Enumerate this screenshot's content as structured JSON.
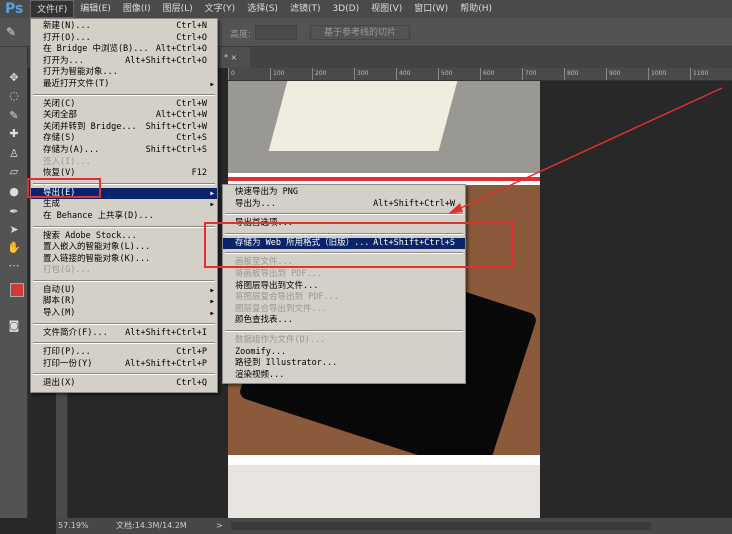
{
  "app": {
    "logo": "Ps"
  },
  "menubar": [
    "文件(F)",
    "编辑(E)",
    "图像(I)",
    "图层(L)",
    "文字(Y)",
    "选择(S)",
    "滤镜(T)",
    "3D(D)",
    "视图(V)",
    "窗口(W)",
    "帮助(H)"
  ],
  "options": {
    "height_label": "高度:",
    "slice_button": "基于参考线的切片"
  },
  "tab": {
    "label": "* ×"
  },
  "ruler": [
    "0",
    "100",
    "200",
    "300",
    "400",
    "500",
    "600",
    "700",
    "800",
    "900",
    "1000",
    "1100"
  ],
  "status": {
    "zoom": "57.19%",
    "doc": "文档:14.3M/14.2M",
    "arrow": ">"
  },
  "file_menu": [
    {
      "label": "新建(N)...",
      "shortcut": "Ctrl+N"
    },
    {
      "label": "打开(O)...",
      "shortcut": "Ctrl+O"
    },
    {
      "label": "在 Bridge 中浏览(B)...",
      "shortcut": "Alt+Ctrl+O"
    },
    {
      "label": "打开为...",
      "shortcut": "Alt+Shift+Ctrl+O"
    },
    {
      "label": "打开为智能对象...",
      "shortcut": ""
    },
    {
      "label": "最近打开文件(T)",
      "shortcut": "",
      "sub": true
    },
    {
      "sep": true
    },
    {
      "label": "关闭(C)",
      "shortcut": "Ctrl+W"
    },
    {
      "label": "关闭全部",
      "shortcut": "Alt+Ctrl+W"
    },
    {
      "label": "关闭并转到 Bridge...",
      "shortcut": "Shift+Ctrl+W"
    },
    {
      "label": "存储(S)",
      "shortcut": "Ctrl+S"
    },
    {
      "label": "存储为(A)...",
      "shortcut": "Shift+Ctrl+S"
    },
    {
      "label": "签入(I)...",
      "shortcut": "",
      "dis": true
    },
    {
      "label": "恢复(V)",
      "shortcut": "F12"
    },
    {
      "sep": true
    },
    {
      "label": "导出(E)",
      "shortcut": "",
      "sub": true,
      "hl": true
    },
    {
      "label": "生成",
      "shortcut": "",
      "sub": true
    },
    {
      "label": "在 Behance 上共享(D)...",
      "shortcut": ""
    },
    {
      "sep": true
    },
    {
      "label": "搜索 Adobe Stock...",
      "shortcut": ""
    },
    {
      "label": "置入嵌入的智能对象(L)...",
      "shortcut": ""
    },
    {
      "label": "置入链接的智能对象(K)...",
      "shortcut": ""
    },
    {
      "label": "打包(G)...",
      "shortcut": "",
      "dis": true
    },
    {
      "sep": true
    },
    {
      "label": "自动(U)",
      "shortcut": "",
      "sub": true
    },
    {
      "label": "脚本(R)",
      "shortcut": "",
      "sub": true
    },
    {
      "label": "导入(M)",
      "shortcut": "",
      "sub": true
    },
    {
      "sep": true
    },
    {
      "label": "文件简介(F)...",
      "shortcut": "Alt+Shift+Ctrl+I"
    },
    {
      "sep": true
    },
    {
      "label": "打印(P)...",
      "shortcut": "Ctrl+P"
    },
    {
      "label": "打印一份(Y)",
      "shortcut": "Alt+Shift+Ctrl+P"
    },
    {
      "sep": true
    },
    {
      "label": "退出(X)",
      "shortcut": "Ctrl+Q"
    }
  ],
  "export_menu": [
    {
      "label": "快速导出为 PNG",
      "shortcut": ""
    },
    {
      "label": "导出为...",
      "shortcut": "Alt+Shift+Ctrl+W"
    },
    {
      "sep": true
    },
    {
      "label": "导出首选项...",
      "shortcut": ""
    },
    {
      "sep": true
    },
    {
      "label": "存储为 Web 所用格式（旧版）...",
      "shortcut": "Alt+Shift+Ctrl+S",
      "hl": true
    },
    {
      "sep": true
    },
    {
      "label": "画板至文件...",
      "shortcut": "",
      "dis": true
    },
    {
      "label": "将画板导出到 PDF...",
      "shortcut": "",
      "dis": true
    },
    {
      "label": "将图层导出到文件...",
      "shortcut": ""
    },
    {
      "label": "将图层复合导出到 PDF...",
      "shortcut": "",
      "dis": true
    },
    {
      "label": "图层复合导出到文件...",
      "shortcut": "",
      "dis": true
    },
    {
      "label": "颜色查找表...",
      "shortcut": ""
    },
    {
      "sep": true
    },
    {
      "label": "数据组作为文件(D)...",
      "shortcut": "",
      "dis": true
    },
    {
      "label": "Zoomify...",
      "shortcut": ""
    },
    {
      "label": "路径到 Illustrator...",
      "shortcut": ""
    },
    {
      "label": "渲染视频...",
      "shortcut": ""
    }
  ],
  "colors": {
    "highlight": "#0a246a",
    "annotation": "#e03030",
    "menu_bg": "#d4d0c8"
  }
}
